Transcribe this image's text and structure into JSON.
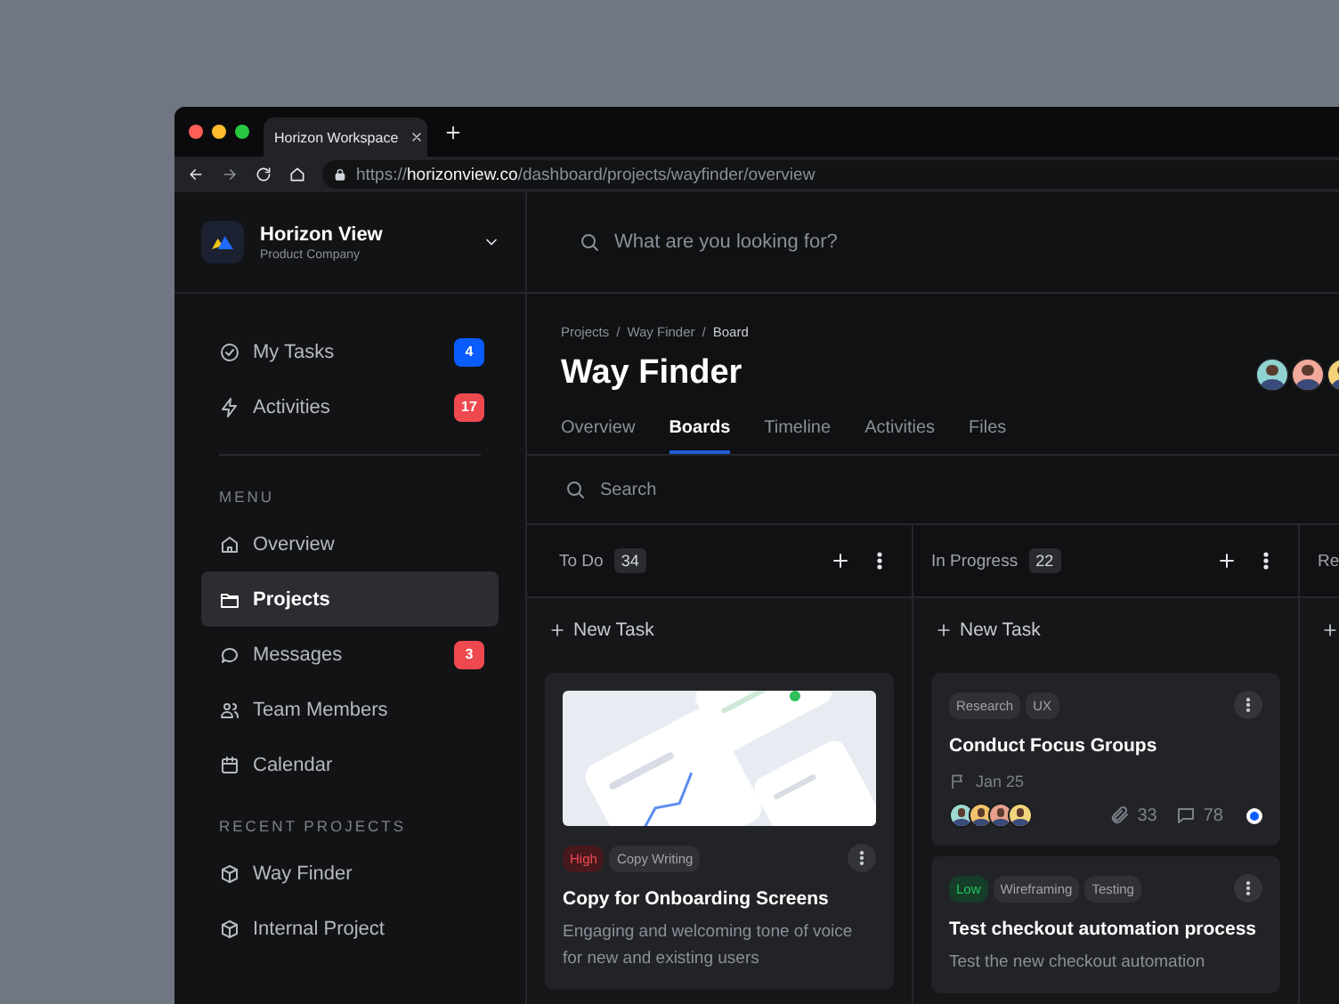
{
  "browser": {
    "tabs": [
      {
        "title": "Horizon Workspace",
        "selected": true
      }
    ],
    "url": "https://**horizonview.co**/dashboard/projects/wayfinder/overview"
  },
  "workspace": {
    "name": "Horizon View",
    "subtitle": "Product Company"
  },
  "quick_links": [
    {
      "label": "My Tasks",
      "selected": false,
      "badge": "4",
      "color": "#0a5cff"
    },
    {
      "label": "Activities",
      "selected": false,
      "badge": "17",
      "color": "#ef4950"
    }
  ],
  "menu": {
    "heading": "MENU",
    "items": [
      {
        "label": "Overview",
        "selected": false
      },
      {
        "label": "Projects",
        "selected": true
      },
      {
        "label": "Messages",
        "selected": false,
        "badge": "3",
        "color": "#ef4950"
      },
      {
        "label": "Team Members",
        "selected": false
      },
      {
        "label": "Calendar",
        "selected": false
      }
    ]
  },
  "recent_projects": {
    "heading": "RECENT PROJECTS",
    "items": [
      {
        "label": "Way Finder",
        "selected": false
      },
      {
        "label": "Internal Project",
        "selected": false
      }
    ]
  },
  "search": {
    "placeholder": "What are you looking for?"
  },
  "page": {
    "breadcrumb": [
      {
        "label": "Projects",
        "selected": false
      },
      {
        "label": "Way Finder",
        "selected": false
      },
      {
        "label": "Board",
        "selected": true
      }
    ],
    "separator": "/",
    "title": "Way Finder",
    "tabs": [
      {
        "label": "Overview",
        "selected": false
      },
      {
        "label": "Boards",
        "selected": true
      },
      {
        "label": "Timeline",
        "selected": false
      },
      {
        "label": "Activities",
        "selected": false
      },
      {
        "label": "Files",
        "selected": false
      }
    ],
    "search": {
      "placeholder": "Search"
    }
  },
  "columns": [
    {
      "name": "To Do",
      "count": "34",
      "new_task": "New Task",
      "cards": [
        {
          "kind": "picture",
          "tags": [
            {
              "label": "High",
              "kind": "high"
            },
            {
              "label": "Copy Writing",
              "kind": "plain"
            }
          ],
          "title": "Copy for Onboarding Screens",
          "description": "Engaging and welcoming tone of voice for new and existing users"
        }
      ]
    },
    {
      "name": "In Progress",
      "count": "22",
      "new_task": "New Task",
      "cards": [
        {
          "kind": "plain",
          "tags": [
            {
              "label": "Research",
              "kind": "plain"
            },
            {
              "label": "UX",
              "kind": "plain"
            }
          ],
          "title": "Conduct Focus Groups",
          "due": "Jan 25",
          "attachments": "33",
          "comments": "78",
          "color": "#0a5cff"
        },
        {
          "kind": "plain",
          "tags": [
            {
              "label": "Low",
              "kind": "low"
            },
            {
              "label": "Wireframing",
              "kind": "plain"
            },
            {
              "label": "Testing",
              "kind": "plain"
            }
          ],
          "title": "Test checkout automation process",
          "description": "Test the new checkout automation"
        }
      ]
    },
    {
      "name": "Re"
    }
  ]
}
